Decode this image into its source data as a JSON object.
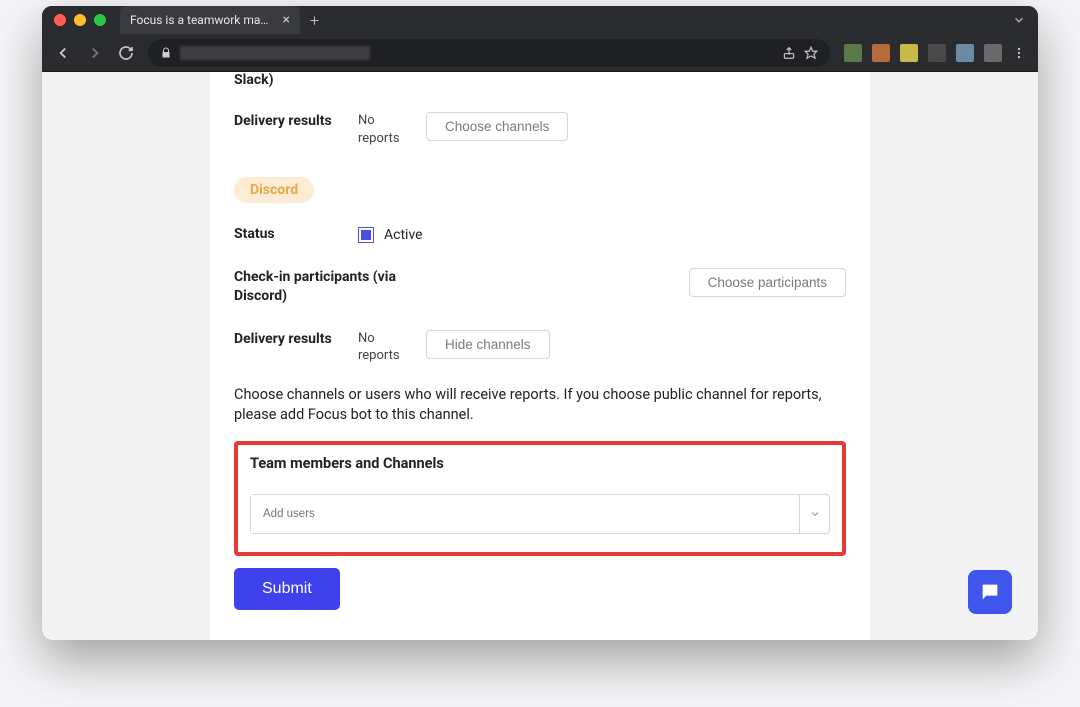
{
  "browser": {
    "tab_title": "Focus is a teamwork managem"
  },
  "top_partial": {
    "slack_label_tail": "Slack)"
  },
  "delivery1": {
    "label": "Delivery results",
    "status_line1": "No",
    "status_line2": "reports",
    "button": "Choose channels"
  },
  "discord_pill": "Discord",
  "status": {
    "label": "Status",
    "value": "Active"
  },
  "participants": {
    "label_line1": "Check-in participants (via",
    "label_line2": "Discord)",
    "button": "Choose participants"
  },
  "delivery2": {
    "label": "Delivery results",
    "status_line1": "No",
    "status_line2": "reports",
    "button": "Hide channels"
  },
  "helper": "Choose channels or users who will receive reports. If you choose public channel for reports, please add Focus bot to this channel.",
  "team": {
    "label": "Team members and Channels",
    "placeholder": "Add users"
  },
  "submit": "Submit"
}
